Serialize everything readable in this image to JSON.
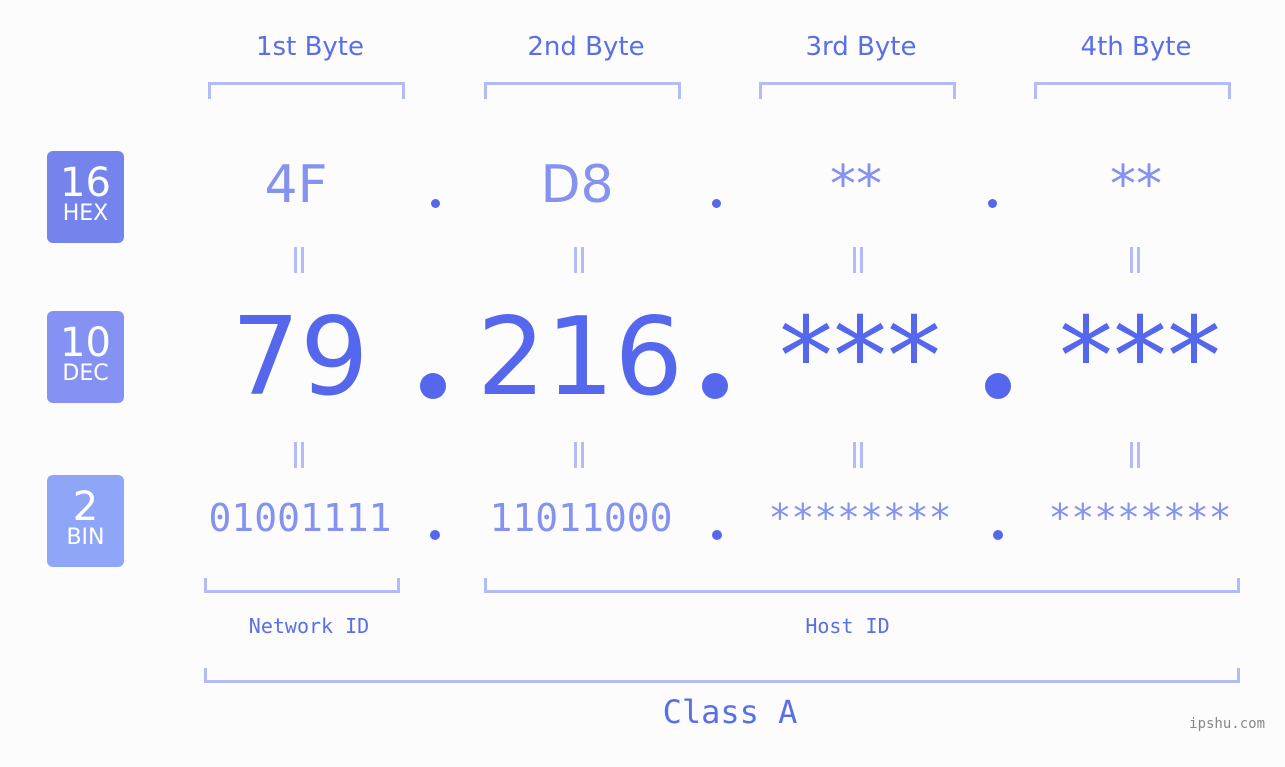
{
  "byte_headers": [
    "1st Byte",
    "2nd Byte",
    "3rd Byte",
    "4th Byte"
  ],
  "badges": [
    {
      "number": "16",
      "label": "HEX",
      "color": "#7584ed"
    },
    {
      "number": "10",
      "label": "DEC",
      "color": "#8592f4"
    },
    {
      "number": "2",
      "label": "BIN",
      "color": "#8fa5f8"
    }
  ],
  "hex": [
    "4F",
    "D8",
    "**",
    "**"
  ],
  "dec": [
    "79",
    "216",
    "***",
    "***"
  ],
  "bin": [
    "01001111",
    "11011000",
    "********",
    "********"
  ],
  "segments": {
    "network": "Network ID",
    "host": "Host ID"
  },
  "class_label": "Class A",
  "watermark": "ipshu.com"
}
